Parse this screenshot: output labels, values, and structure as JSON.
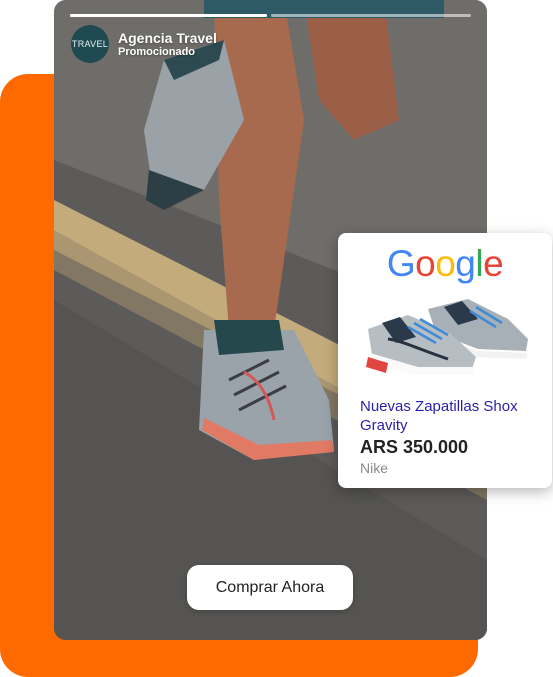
{
  "story": {
    "avatar_label": "TRAVEL",
    "brand_name": "Agencia Travel",
    "sponsored_label": "Promocionado",
    "progress": [
      1.0,
      0.0
    ],
    "cta_label": "Comprar Ahora"
  },
  "ad_card": {
    "logo_text": "Google",
    "logo_colors": [
      "#4285F4",
      "#EA4335",
      "#FBBC05",
      "#4285F4",
      "#34A853",
      "#EA4335"
    ],
    "product_title": "Nuevas Zapatillas Shox Gravity",
    "price": "ARS 350.000",
    "seller": "Nike"
  },
  "colors": {
    "accent": "#ff6a00",
    "avatar_bg": "#1f4a52",
    "link_blue": "#2a1fa8"
  }
}
